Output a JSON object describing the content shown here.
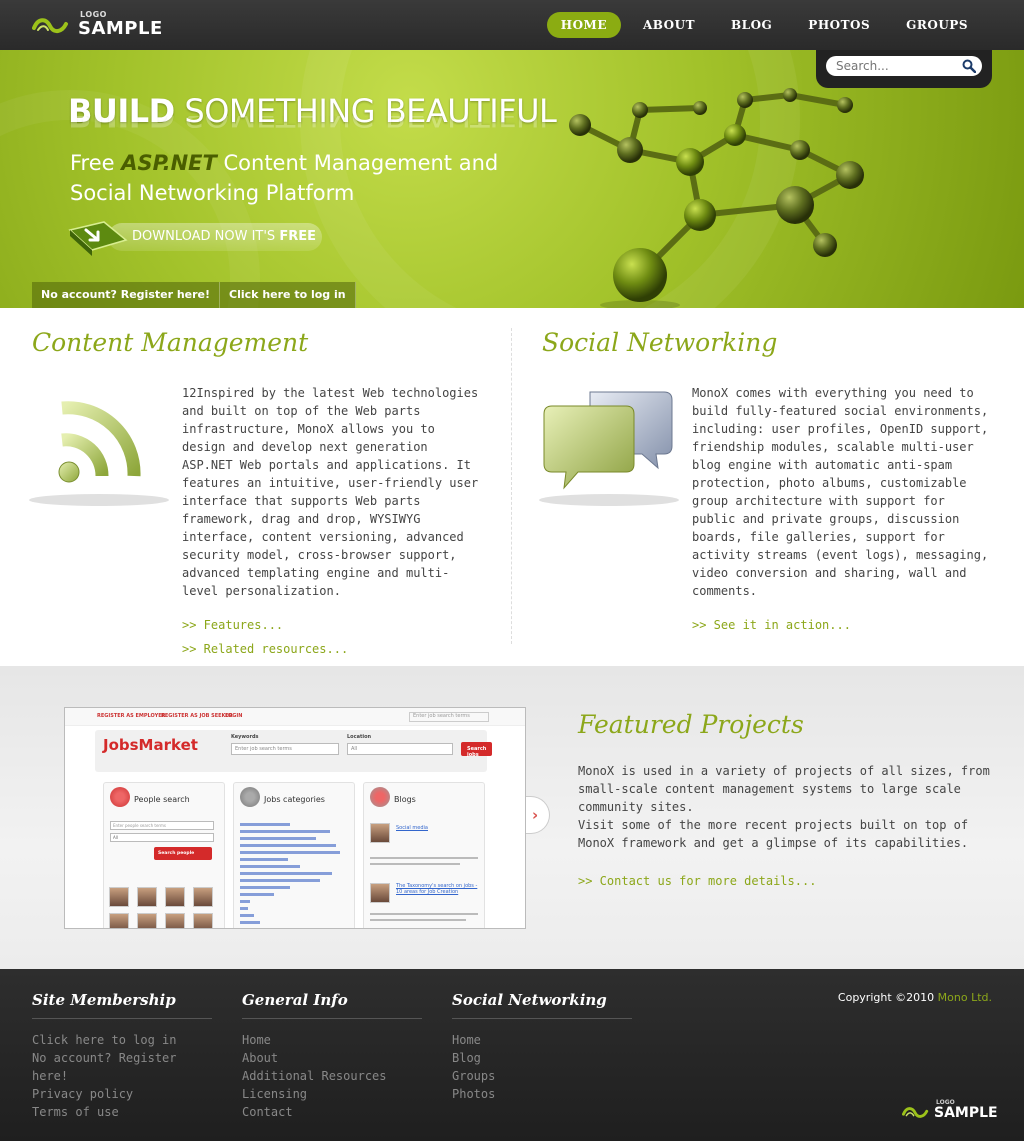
{
  "header": {
    "logo_small": "LOGO",
    "logo_big": "SAMPLE",
    "nav": [
      {
        "label": "HOME",
        "active": true
      },
      {
        "label": "ABOUT",
        "active": false
      },
      {
        "label": "BLOG",
        "active": false
      },
      {
        "label": "PHOTOS",
        "active": false
      },
      {
        "label": "GROUPS",
        "active": false
      }
    ],
    "search_placeholder": "Search..."
  },
  "hero": {
    "title_bold": "BUILD",
    "title_rest": " SOMETHING BEAUTIFUL",
    "subtitle_pre": "Free ",
    "subtitle_em": "ASP.NET",
    "subtitle_line1_post": " Content Management and",
    "subtitle_line2": "Social Networking Platform",
    "download_label": "DOWNLOAD NOW IT'S ",
    "download_label_bold": "FREE",
    "register_link": "No account? Register here!",
    "login_link": "Click here to log in"
  },
  "content_management": {
    "heading": "Content Management",
    "body": "12Inspired by the latest Web technologies and built on top of the Web parts infrastructure, MonoX allows you to design and develop next generation ASP.NET Web portals and applications. It features an intuitive, user-friendly user interface that supports Web parts framework, drag and drop, WYSIWYG interface, content versioning, advanced security model, cross-browser support, advanced templating engine and multi-level personalization.",
    "link1": ">> Features...",
    "link2": ">> Related resources..."
  },
  "social_networking": {
    "heading": "Social Networking",
    "body": "MonoX comes with everything you need to build fully-featured social environments, including: user profiles, OpenID support, friendship modules, scalable multi-user blog engine with automatic anti-spam protection, photo albums, customizable group architecture with support for public and private groups, discussion boards, file galleries, support for activity streams (event logs), messaging, video conversion and sharing, wall and comments.",
    "link1": ">> See it in action..."
  },
  "featured": {
    "heading": "Featured Projects",
    "para1": "MonoX is used in a variety of projects of all sizes, from small-scale content management systems to large scale community sites.",
    "para2": "Visit some of the more recent projects built on top of MonoX framework and get a glimpse of its capabilities.",
    "link": ">> Contact us for more details...",
    "next_icon": "›",
    "screenshot": {
      "top_link1": "REGISTER AS EMPLOYER",
      "top_link2": "REGISTER AS JOB SEEKER",
      "top_link3": "LOGIN",
      "top_search": "Enter job search terms",
      "brand": "JobsMarket",
      "keywords_label": "Keywords",
      "keywords_placeholder": "Enter job search terms",
      "location_label": "Location",
      "location_value": "All",
      "search_button": "Search jobs",
      "panel1_title": "People search",
      "panel1_placeholder": "Enter people search terms",
      "panel1_select": "All",
      "panel1_button": "Search people",
      "panel2_title": "Jobs categories",
      "panel3_title": "Blogs",
      "panel3_post1": "Social media",
      "panel3_post2": "The Taxonomy's search on jobs - 10 areas for Job Creation"
    }
  },
  "footer": {
    "membership_title": "Site Membership",
    "membership_links": [
      "Click here to log in",
      "No account? Register here!",
      "Privacy policy",
      "Terms of use"
    ],
    "general_title": "General Info",
    "general_links": [
      "Home",
      "About",
      "Additional Resources",
      "Licensing",
      "Contact"
    ],
    "social_title": "Social Networking",
    "social_links": [
      "Home",
      "Blog",
      "Groups",
      "Photos"
    ],
    "copyright_pre": "Copyright ©2010 ",
    "copyright_company": "Mono Ltd.",
    "logo_small": "LOGO",
    "logo_big": "SAMPLE"
  },
  "colors": {
    "accent": "#8ca71a",
    "header_bg": "#2e2e2e",
    "hero_green": "#a2c22a"
  }
}
